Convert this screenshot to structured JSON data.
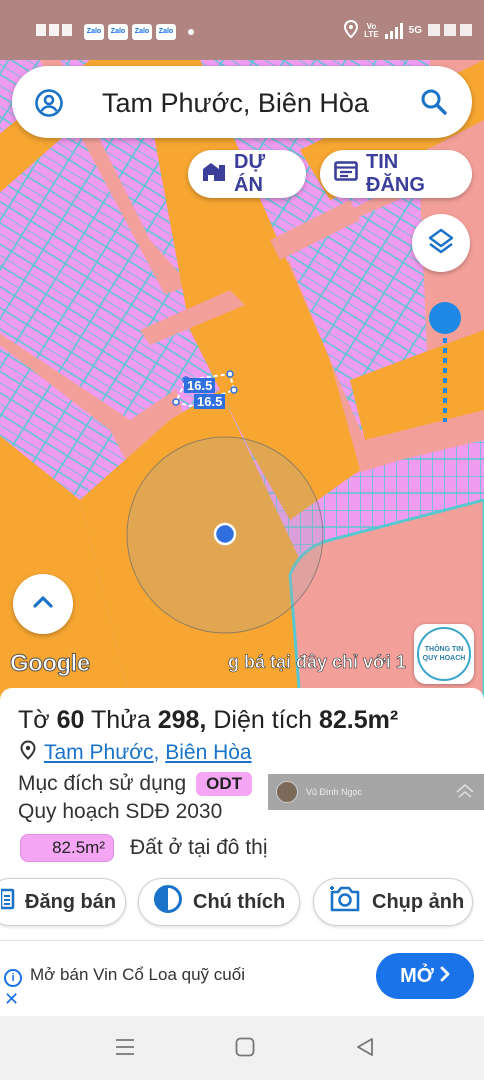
{
  "status_bar": {
    "apps": [
      "Zalo",
      "Zalo",
      "Zalo",
      "Zalo"
    ],
    "network_label": "Vo LTE",
    "network_label_top": "Vo",
    "network_label_bottom": "LTE",
    "carrier": "5G"
  },
  "search": {
    "query": "Tam Phước, Biên Hòa"
  },
  "map": {
    "chip_duan": "DỰ ÁN",
    "chip_tindang": "TIN ĐĂNG",
    "plot_label_1": "16.5",
    "plot_label_2": "16.5",
    "google": "Google",
    "ad_ticker": "g bá tại đây chỉ với 1",
    "planning_info_line1": "THÔNG TIN",
    "planning_info_line2": "QUY HOẠCH",
    "colors": {
      "residential": "#ef9bef",
      "road": "#f6a631",
      "background": "#f4a09a",
      "plot_border": "#58c8d0",
      "accent": "#1e88e5"
    }
  },
  "panel": {
    "title_prefix": "Tờ",
    "sheet": "60",
    "parcel_label": "Thửa",
    "parcel": "298,",
    "area_label": "Diện tích",
    "area": "82.5m²",
    "loc_ward": "Tam Phước",
    "loc_sep": ",",
    "loc_city": "Biên Hòa",
    "purpose_label": "Mục đích sử dụng",
    "purpose_code": "ODT",
    "watermark_name": "Vũ Đình Ngọc",
    "plan_label": "Quy hoạch SDĐ 2030",
    "area_badge": "82.5m²",
    "area_desc": "Đất ở tại đô thị",
    "actions": {
      "sell": "Đăng bán",
      "legend": "Chú thích",
      "photo": "Chụp ảnh"
    }
  },
  "ad": {
    "text": "Mở bán Vin Cổ Loa quỹ cuối",
    "open": "MỞ"
  }
}
